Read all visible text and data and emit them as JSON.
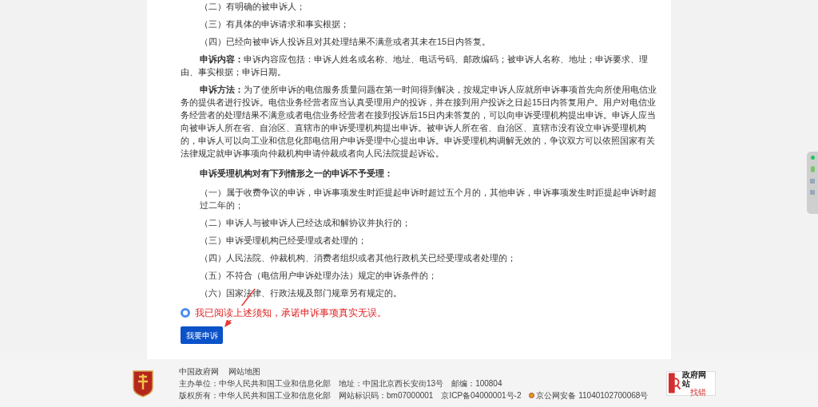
{
  "notice": [
    {
      "kind": "item",
      "text": "（二）有明确的被申诉人；"
    },
    {
      "kind": "item",
      "text": "（三）有具体的申诉请求和事实根据；"
    },
    {
      "kind": "item",
      "text": "（四）已经向被申诉人投诉且对其处理结果不满意或者其未在15日内答复。"
    },
    {
      "kind": "para",
      "text": "**申诉内容：**申诉内容应包括：申诉人姓名或名称、地址、电话号码、邮政编码；被申诉人名称、地址；申诉要求、理由、事实根据；申诉日期。"
    },
    {
      "kind": "para",
      "text": "**申诉方法：**为了使所申诉的电信服务质量问题在第一时间得到解决，按规定申诉人应就所申诉事项首先向所使用电信业务的提供者进行投诉。电信业务经营者应当认真受理用户的投诉，并在接到用户投诉之日起15日内答复用户。用户对电信业务经营者的处理结果不满意或者电信业务经营者在接到投诉后15日内未答复的，可以向申诉受理机构提出申诉。申诉人应当向被申诉人所在省、自治区、直辖市的申诉受理机构提出申诉。被申诉人所在省、自治区、直辖市没有设立申诉受理机构的，申诉人可以向工业和信息化部电信用户申诉受理中心提出申诉。申诉受理机构调解无效的，争议双方可以依照国家有关法律规定就申诉事项向仲裁机构申请仲裁或者向人民法院提起诉讼。"
    },
    {
      "kind": "heading",
      "text": "申诉受理机构对有下列情形之一的申诉不予受理："
    },
    {
      "kind": "item",
      "text": "（一）属于收费争议的申诉，申诉事项发生时距提起申诉时超过五个月的，其他申诉，申诉事项发生时距提起申诉时超过二年的；"
    },
    {
      "kind": "item",
      "text": "（二）申诉人与被申诉人已经达成和解协议并执行的；"
    },
    {
      "kind": "item",
      "text": "（三）申诉受理机构已经受理或者处理的；"
    },
    {
      "kind": "item",
      "text": "（四）人民法院、仲裁机构、消费者组织或者其他行政机关已经受理或者处理的；"
    },
    {
      "kind": "item",
      "text": "（五）不符合（电信用户申诉处理办法）规定的申诉条件的；"
    },
    {
      "kind": "item",
      "text": "（六）国家法律、行政法规及部门规章另有规定的。"
    }
  ],
  "agreement": {
    "label": "我已阅读上述须知，承诺申诉事项真实无误。",
    "selected": true
  },
  "submit_button": "我要申诉",
  "footer": {
    "links": [
      "中国政府网",
      "网站地图"
    ],
    "rows": [
      [
        "主办单位：中华人民共和国工业和信息化部",
        "地址：中国北京西长安街13号",
        "邮编：100804"
      ],
      [
        "版权所有：中华人民共和国工业和信息化部",
        "网站标识码：bm07000001",
        "京ICP备04000001号-2",
        "京公网安备 11040102700068号"
      ]
    ],
    "badge": {
      "title": "政府网站",
      "subtitle": "找错"
    }
  }
}
